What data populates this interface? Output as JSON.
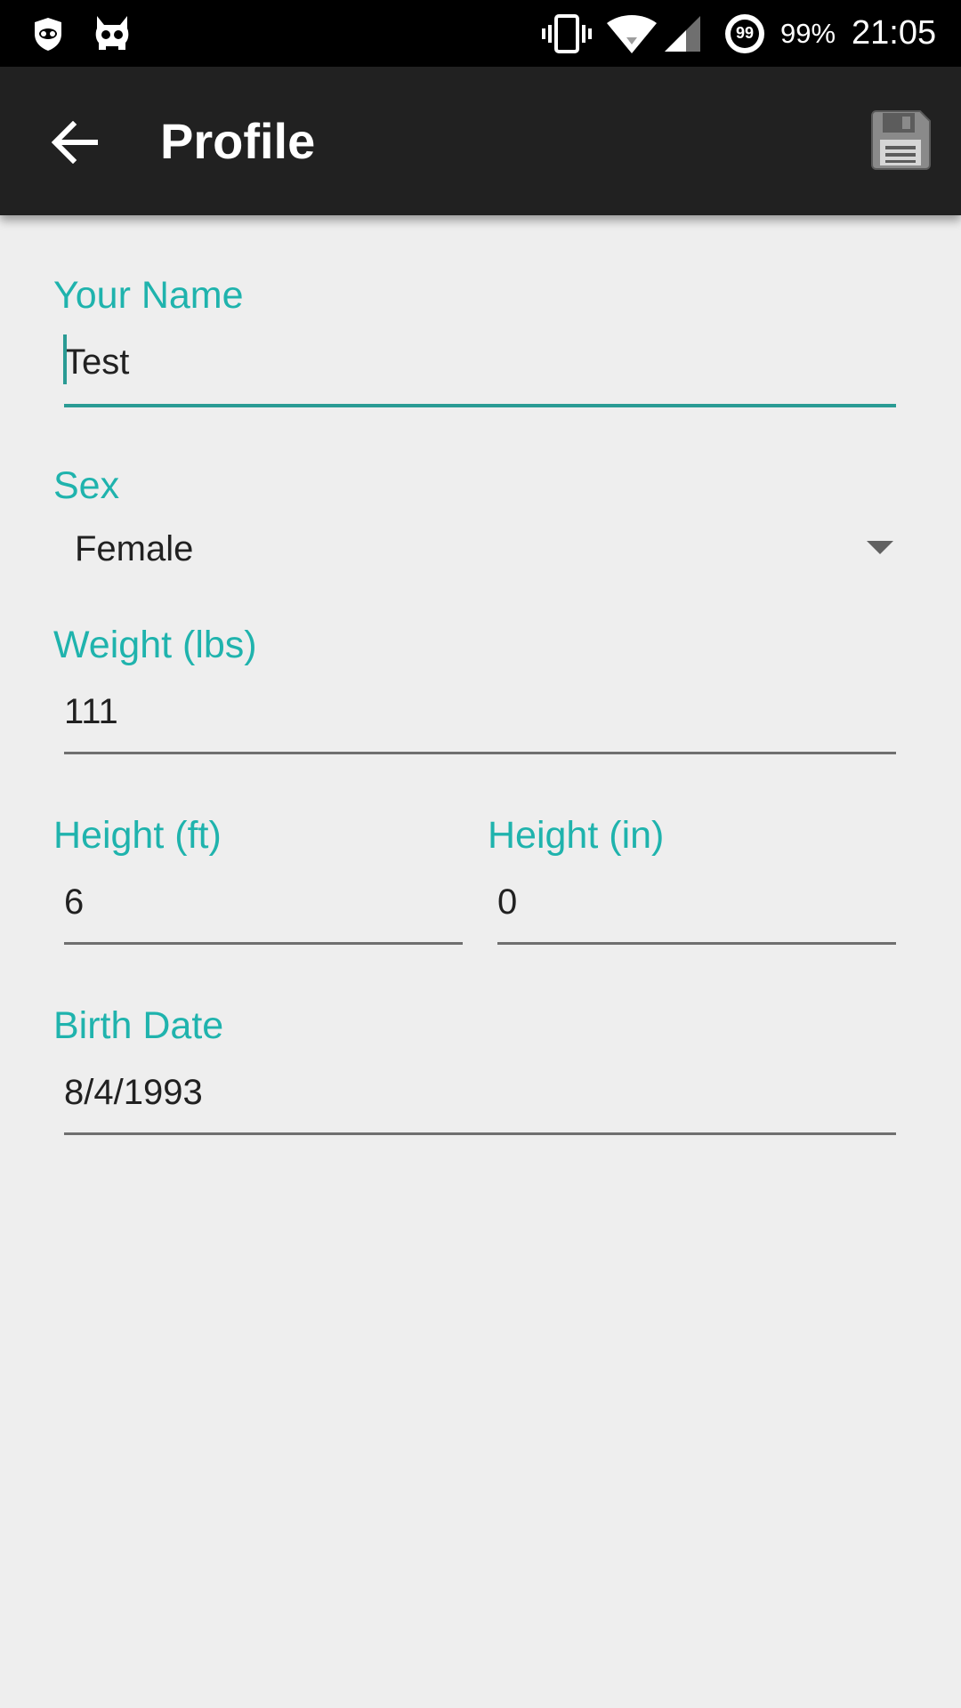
{
  "status_bar": {
    "battery_percent": "99%",
    "time": "21:05",
    "icons": [
      "privacy-guard-icon",
      "cyanogen-mascot-icon",
      "vibrate-icon",
      "wifi-icon",
      "cellular-signal-icon",
      "battery-icon"
    ],
    "battery_icon_label": "99"
  },
  "app_bar": {
    "title": "Profile",
    "back_icon": "arrow-back-icon",
    "save_icon": "save-floppy-icon"
  },
  "form": {
    "name": {
      "label": "Your Name",
      "value": "Test"
    },
    "sex": {
      "label": "Sex",
      "selected": "Female"
    },
    "weight": {
      "label": "Weight (lbs)",
      "value": "111"
    },
    "height_ft": {
      "label": "Height (ft)",
      "value": "6"
    },
    "height_in": {
      "label": "Height (in)",
      "value": "0"
    },
    "birth_date": {
      "label": "Birth Date",
      "value": "8/4/1993"
    }
  },
  "colors": {
    "accent": "#1fb3ad",
    "app_bar": "#212121",
    "status_bar": "#000000",
    "background": "#eeeeee"
  }
}
